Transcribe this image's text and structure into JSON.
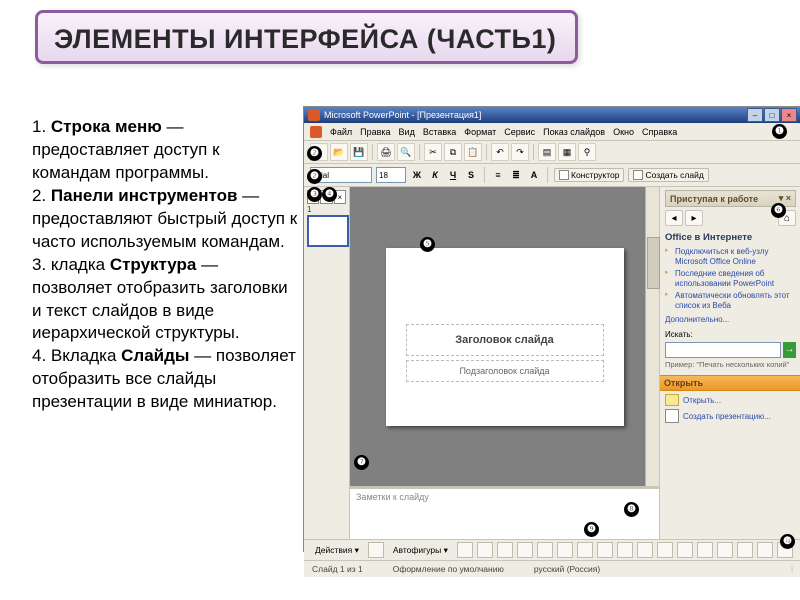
{
  "title": "ЭЛЕМЕНТЫ ИНТЕРФЕЙСА (ЧАСТЬ1)",
  "body": {
    "p1a": "1. ",
    "p1b": "Строка меню",
    "p1c": " — предоставляет доступ к командам программы.",
    "p2a": "2. ",
    "p2b": "Панели инструментов",
    "p2c": " — предоставляют быстрый доступ к часто используемым командам.",
    "p3a": "3. кладка ",
    "p3b": "Структура",
    "p3c": " — позволяет отобразить заголовки и текст слайдов в виде иерархической структуры.",
    "p4a": "4. Вкладка ",
    "p4b": "Слайды",
    "p4c": " — позволяет отобразить все слайды презентации в виде миниатюр."
  },
  "ppt": {
    "title": "Microsoft PowerPoint - [Презентация1]",
    "menu": [
      "Файл",
      "Правка",
      "Вид",
      "Вставка",
      "Формат",
      "Сервис",
      "Показ слайдов",
      "Окно",
      "Справка"
    ],
    "font": "Arial",
    "size": "18",
    "btn_constructor": "Конструктор",
    "btn_newslide": "Создать слайд",
    "thumb_num": "1",
    "slide_title": "Заголовок слайда",
    "slide_sub": "Подзаголовок слайда",
    "notes": "Заметки к слайду",
    "pane": {
      "title": "Приступая к работе",
      "office_h": "Office в Интернете",
      "links": [
        "Подключиться к веб-узлу Microsoft Office Online",
        "Последние сведения об использовании PowerPoint",
        "Автоматически обновлять этот список из Веба"
      ],
      "more": "Дополнительно...",
      "search_label": "Искать:",
      "example": "Пример: \"Печать нескольких копий\"",
      "open_h": "Открыть",
      "open_link": "Открыть...",
      "create_link": "Создать презентацию..."
    },
    "draw": {
      "actions": "Действия",
      "autoshapes": "Автофигуры"
    },
    "status": {
      "slide": "Слайд 1 из 1",
      "layout": "Оформление по умолчанию",
      "lang": "русский (Россия)"
    }
  },
  "badges": [
    "❶",
    "❷",
    "❸",
    "❹",
    "❺",
    "❻",
    "❼",
    "❽",
    "❾",
    "❿"
  ]
}
